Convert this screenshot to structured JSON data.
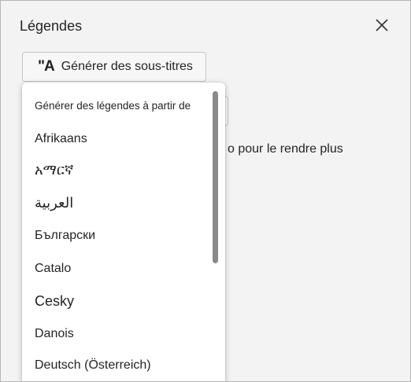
{
  "dialog": {
    "title": "Légendes",
    "close_icon": "close-icon"
  },
  "generate_button": {
    "icon": "closed-captions-icon",
    "icon_glyph": "\"A",
    "label": "Générer des sous-titres"
  },
  "background_text": "o pour le rendre plus",
  "dropdown": {
    "header": "Générer des légendes à partir de",
    "languages": [
      "Afrikaans",
      "አማርኛ",
      "العربية",
      "Български",
      "Catalo",
      "Cesky",
      "Danois",
      "Deutsch (Österreich)"
    ]
  }
}
